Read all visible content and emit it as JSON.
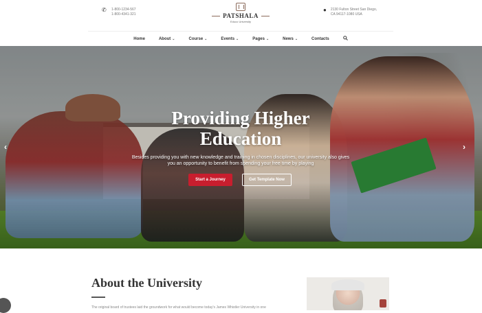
{
  "header": {
    "phones": [
      "1-800-1234-567",
      "1-800-4341-321"
    ],
    "logo": {
      "name": "PATSHALA",
      "subtitle": "Educo University"
    },
    "address": [
      "2130 Fulton Street San Diego,",
      "CA 94117-1080 USA"
    ]
  },
  "nav": {
    "items": [
      {
        "label": "Home",
        "dropdown": false
      },
      {
        "label": "About",
        "dropdown": true
      },
      {
        "label": "Course",
        "dropdown": true
      },
      {
        "label": "Events",
        "dropdown": true
      },
      {
        "label": "Pages",
        "dropdown": true
      },
      {
        "label": "News",
        "dropdown": true
      },
      {
        "label": "Contacts",
        "dropdown": false
      }
    ],
    "caret": "⌄",
    "search_icon": "search-icon"
  },
  "hero": {
    "title": "Providing Higher Education",
    "text": "Besides providing you with new knowledge and training in chosen disciplines, our university also gives you an opportunity to benefit from spending your free time by playing",
    "primary_button": "Start a Journey",
    "secondary_button": "Get Template Now",
    "prev_arrow": "‹",
    "next_arrow": "›"
  },
  "about": {
    "title": "About the University",
    "text": "The original board of trustees laid the groundwork for what would become today's James Whistler University in one"
  },
  "colors": {
    "accent_red": "#c81e2e",
    "logo_brown": "#8a6a5a",
    "text_dark": "#333333"
  }
}
